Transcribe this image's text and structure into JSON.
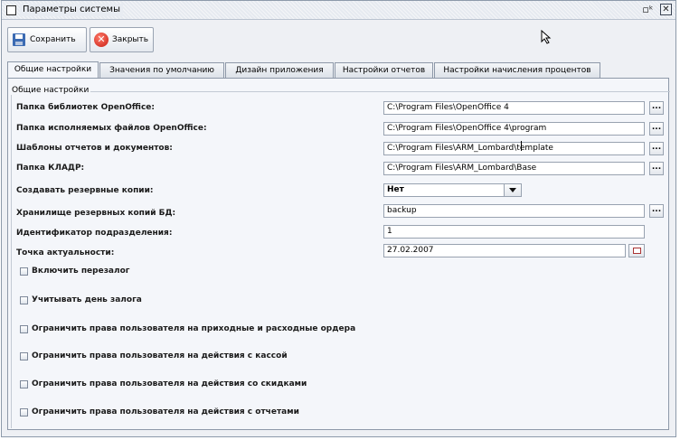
{
  "window": {
    "title": "Параметры системы",
    "restore_symbol": "▫ᵏ",
    "close_symbol": "✕"
  },
  "toolbar": {
    "save_label": "Сохранить",
    "close_label": "Закрыть"
  },
  "tabs": [
    {
      "label": "Общие настройки",
      "active": true
    },
    {
      "label": "Значения по умолчанию",
      "active": false
    },
    {
      "label": "Дизайн приложения",
      "active": false
    },
    {
      "label": "Настройки отчетов",
      "active": false
    },
    {
      "label": "Настройки начисления процентов",
      "active": false
    }
  ],
  "general": {
    "group_title": "Общие настройки",
    "fields": [
      {
        "label": "Папка библиотек OpenOffice:",
        "value": "C:\\Program Files\\OpenOffice 4",
        "browse": "..."
      },
      {
        "label": "Папка исполняемых файлов OpenOffice:",
        "value": "C:\\Program Files\\OpenOffice 4\\program",
        "browse": "..."
      },
      {
        "label": "Шаблоны отчетов и документов:",
        "value": "C:\\Program Files\\ARM_Lombard\\template",
        "browse": "..."
      },
      {
        "label": "Папка КЛАДР:",
        "value": "C:\\Program Files\\ARM_Lombard\\Base",
        "browse": "..."
      }
    ],
    "backup": {
      "label": "Создавать резервные копии:",
      "selected": "Нет"
    },
    "backup_storage": {
      "label": "Хранилище резервных копий БД:",
      "value": "backup",
      "browse": "..."
    },
    "division_id": {
      "label": "Идентификатор подразделения:",
      "value": "1"
    },
    "actual_date": {
      "label": "Точка актуальности:",
      "value": "27.02.2007"
    },
    "checkboxes": [
      {
        "label": "Включить перезалог",
        "checked": false
      },
      {
        "label": "Учитывать день залога",
        "checked": false
      },
      {
        "label": "Ограничить права пользователя на приходные и расходные ордера",
        "checked": false
      },
      {
        "label": "Ограничить права пользователя на действия с кассой",
        "checked": false
      },
      {
        "label": "Ограничить права пользователя на действия со скидками",
        "checked": false
      },
      {
        "label": "Ограничить права пользователя на действия с отчетами",
        "checked": false
      }
    ]
  }
}
